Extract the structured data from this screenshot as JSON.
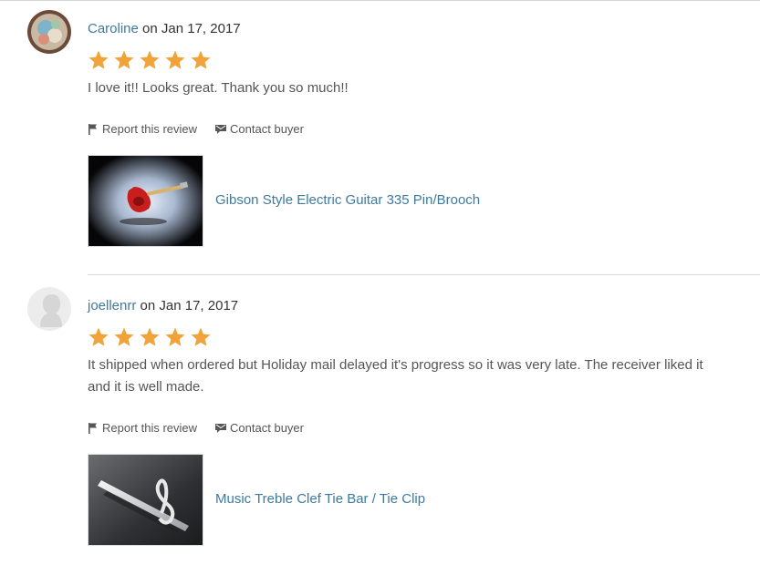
{
  "reviews": [
    {
      "reviewer": "Caroline",
      "date_text": "on Jan 17, 2017",
      "rating": 5,
      "rating_max": 5,
      "text": "I love it!! Looks great. Thank you so much!!",
      "report_label": "Report this review",
      "contact_label": "Contact buyer",
      "listing_title": "Gibson Style Electric Guitar 335 Pin/Brooch"
    },
    {
      "reviewer": "joellenrr",
      "date_text": "on Jan 17, 2017",
      "rating": 5,
      "rating_max": 5,
      "text": "It shipped when ordered but Holiday mail delayed it's progress so it was very late. The receiver liked it and it is well made.",
      "report_label": "Report this review",
      "contact_label": "Contact buyer",
      "listing_title": "Music Treble Clef Tie Bar / Tie Clip"
    }
  ],
  "icons": {
    "star": "star-icon",
    "flag": "flag-icon",
    "message": "message-icon"
  },
  "colors": {
    "link": "#3f7a9e",
    "star": "#f1a33a",
    "text": "#555555"
  }
}
